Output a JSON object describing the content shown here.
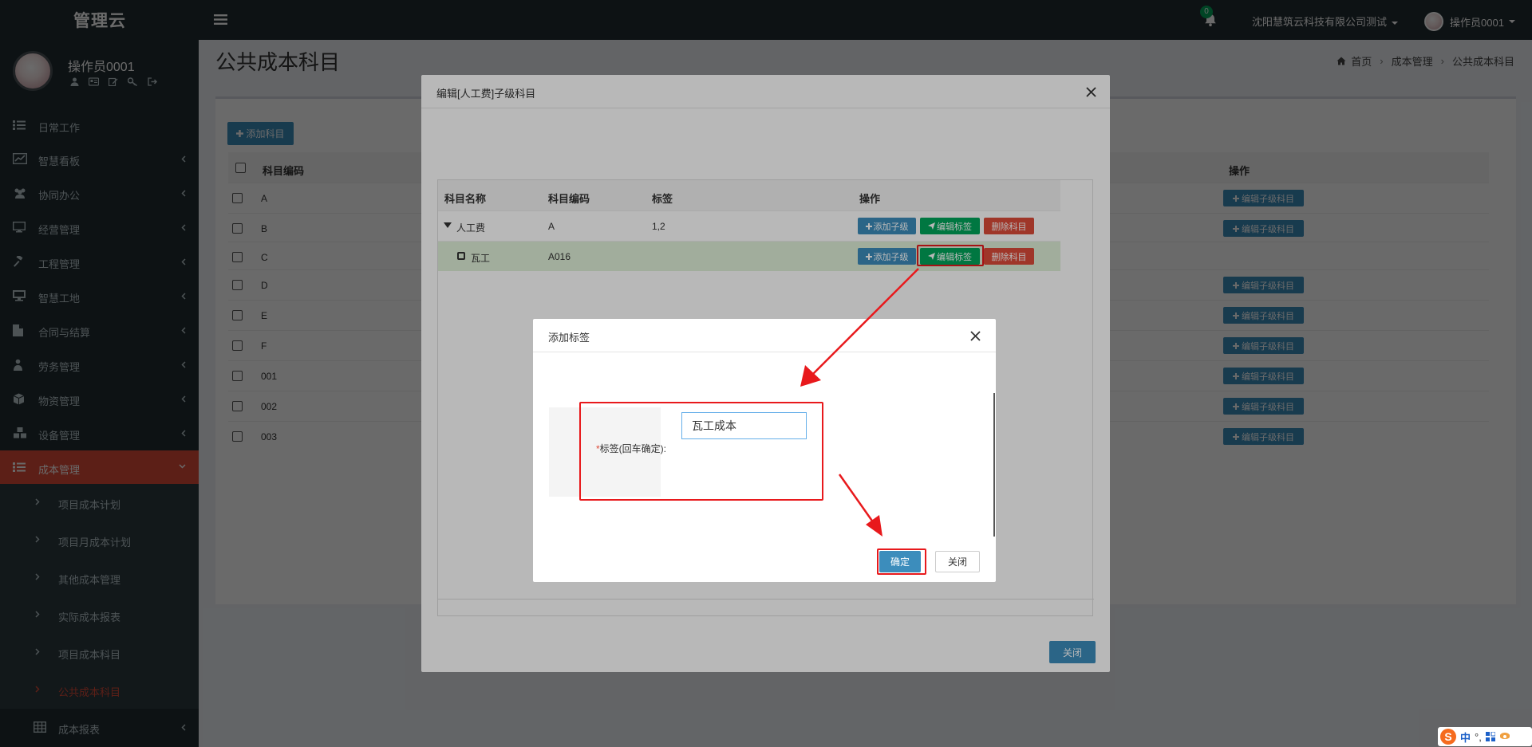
{
  "app": {
    "logo": "管理云"
  },
  "header": {
    "notification_count": "0",
    "company": "沈阳慧筑云科技有限公司测试",
    "user": "操作员0001"
  },
  "sidebar": {
    "user_name": "操作员0001",
    "user_icons": [
      "user-icon",
      "id-card-icon",
      "edit-icon",
      "key-icon",
      "sign-out-icon"
    ],
    "items": [
      {
        "label": "日常工作",
        "icon": "list-icon",
        "has_children": false
      },
      {
        "label": "智慧看板",
        "icon": "dashboard-icon",
        "has_children": true
      },
      {
        "label": "协同办公",
        "icon": "users-icon",
        "has_children": true
      },
      {
        "label": "经营管理",
        "icon": "desktop-icon",
        "has_children": true
      },
      {
        "label": "工程管理",
        "icon": "gavel-icon",
        "has_children": true
      },
      {
        "label": "智慧工地",
        "icon": "monitor-icon",
        "has_children": true
      },
      {
        "label": "合同与结算",
        "icon": "file-icon",
        "has_children": true
      },
      {
        "label": "劳务管理",
        "icon": "worker-icon",
        "has_children": true
      },
      {
        "label": "物资管理",
        "icon": "cube-icon",
        "has_children": true
      },
      {
        "label": "设备管理",
        "icon": "cubes-icon",
        "has_children": true
      },
      {
        "label": "成本管理",
        "icon": "list-icon",
        "has_children": true,
        "active": true
      }
    ],
    "subitems": [
      {
        "label": "项目成本计划"
      },
      {
        "label": "项目月成本计划"
      },
      {
        "label": "其他成本管理"
      },
      {
        "label": "实际成本报表"
      },
      {
        "label": "项目成本科目"
      },
      {
        "label": "公共成本科目",
        "current": true
      }
    ],
    "last_item": {
      "label": "成本报表",
      "icon": "table-icon"
    }
  },
  "page": {
    "title": "公共成本科目",
    "breadcrumb": [
      "首页",
      "成本管理",
      "公共成本科目"
    ]
  },
  "main": {
    "add_button": "添加科目",
    "columns": {
      "code": "科目编码",
      "ops": "操作"
    },
    "rows": [
      {
        "code": "A",
        "has_edit": true
      },
      {
        "code": "B",
        "has_edit": true
      },
      {
        "code": "C",
        "has_edit": false
      },
      {
        "code": "D",
        "has_edit": true
      },
      {
        "code": "E",
        "has_edit": true
      },
      {
        "code": "F",
        "has_edit": true
      },
      {
        "code": "001",
        "has_edit": true
      },
      {
        "code": "002",
        "has_edit": true
      },
      {
        "code": "003",
        "has_edit": true
      }
    ],
    "edit_child_label": "编辑子级科目"
  },
  "modal_edit": {
    "title": "编辑[人工费]子级科目",
    "columns": {
      "name": "科目名称",
      "code": "科目编码",
      "tag": "标签",
      "ops": "操作"
    },
    "rows": [
      {
        "name": "人工费",
        "code": "A",
        "tag": "1,2",
        "expanded": true
      },
      {
        "name": "瓦工",
        "code": "A016",
        "tag": "",
        "selected": true
      }
    ],
    "btn_add_child": "添加子级",
    "btn_edit_tag": "编辑标签",
    "btn_delete": "删除科目",
    "close": "关闭"
  },
  "modal_tag": {
    "title": "添加标签",
    "label_required": "*",
    "label": "标签(回车确定):",
    "input_value": "瓦工成本",
    "confirm": "确定",
    "cancel": "关闭"
  },
  "ime": {
    "lang": "中",
    "punct": "°,",
    "logo": "S"
  },
  "colors": {
    "sidebar_bg": "#222d32",
    "active_menu": "#dd4b39",
    "primary": "#3c8dbc",
    "success": "#00a65a",
    "danger": "#dd4b39",
    "annotation": "#e8191c"
  }
}
